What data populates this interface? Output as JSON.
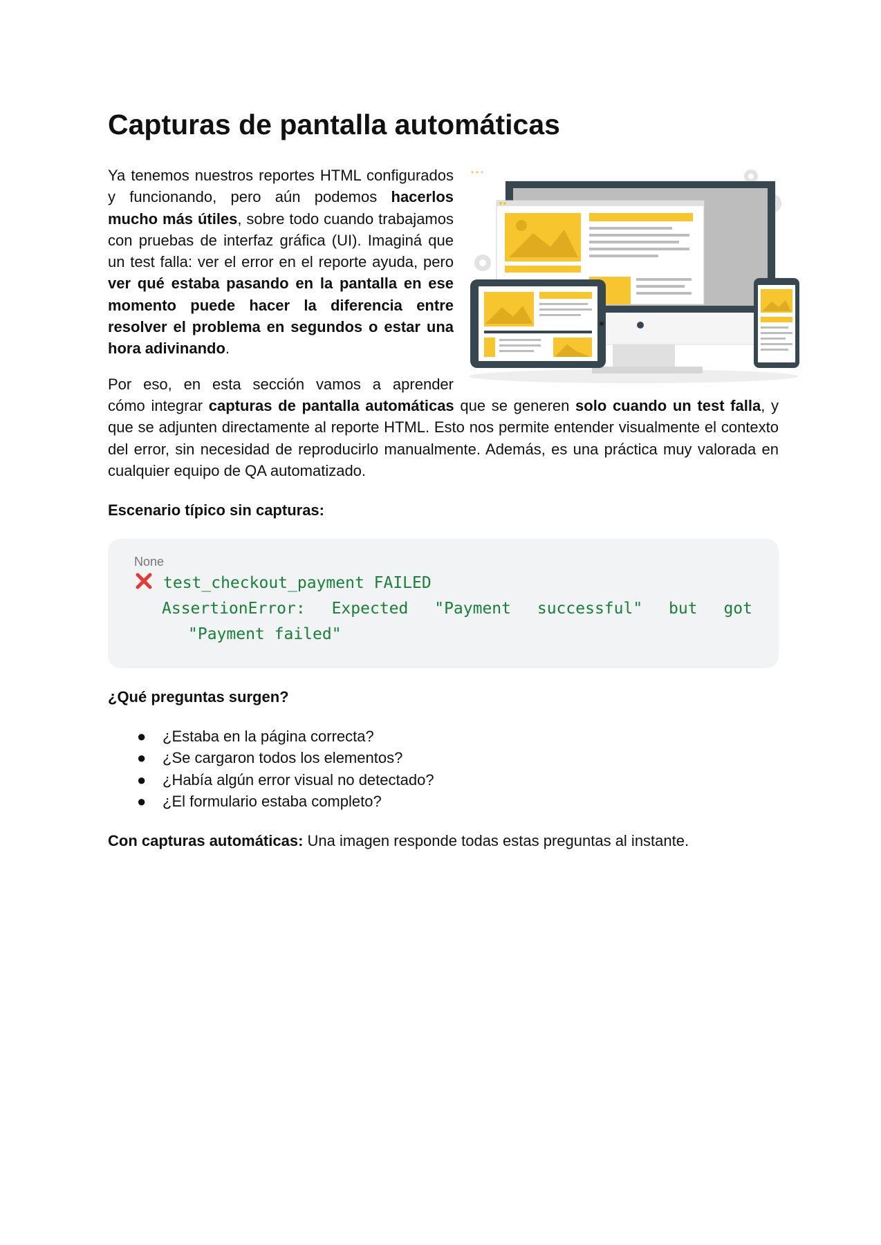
{
  "title": "Capturas de pantalla automáticas",
  "intro": {
    "t1": "Ya tenemos nuestros reportes HTML configurados y funcionando, pero aún podemos ",
    "b1": "hacerlos mucho más útiles",
    "t2": ", sobre todo cuando trabajamos con pruebas de interfaz gráfica (UI). Imaginá que un test falla: ver el error en el reporte ayuda, pero ",
    "b2": "ver qué estaba pasando en la pantalla en ese momento puede hacer la diferencia entre resolver el problema en segundos o estar una hora adivinando",
    "t3": "."
  },
  "section2": {
    "first_line": "Por eso, en esta sección vamos a aprender",
    "t1": "cómo integrar ",
    "b1": "capturas de pantalla automáticas",
    "t2": " que se generen ",
    "b2": "solo cuando un test falla",
    "t3": ", y que se adjunten directamente al reporte HTML. Esto nos permite entender visualmente el contexto del error, sin necesidad de reproducirlo manualmente. Además, es una práctica muy valorada en cualquier equipo de QA automatizado."
  },
  "scenario_heading": "Escenario típico sin capturas:",
  "code": {
    "language": "None",
    "line1": "test_checkout_payment FAILED",
    "line2_words": [
      "AssertionError:",
      "Expected",
      "\"Payment",
      "successful\"",
      "but",
      "got"
    ],
    "line3": "\"Payment failed\"",
    "icon": "cross-mark-icon",
    "icon_color": "#e53935",
    "code_color": "#188038"
  },
  "questions_heading": "¿Qué preguntas surgen?",
  "questions": [
    "¿Estaba en la página correcta?",
    "¿Se cargaron todos los elementos?",
    "¿Había algún error visual no detectado?",
    "¿El formulario estaba completo?"
  ],
  "bullet_char": "●",
  "final": {
    "bold": "Con capturas automáticas:",
    "text": " Una imagen responde todas estas preguntas al instante."
  },
  "colors": {
    "accent_yellow": "#f7c62f",
    "device_dark": "#37474f"
  }
}
